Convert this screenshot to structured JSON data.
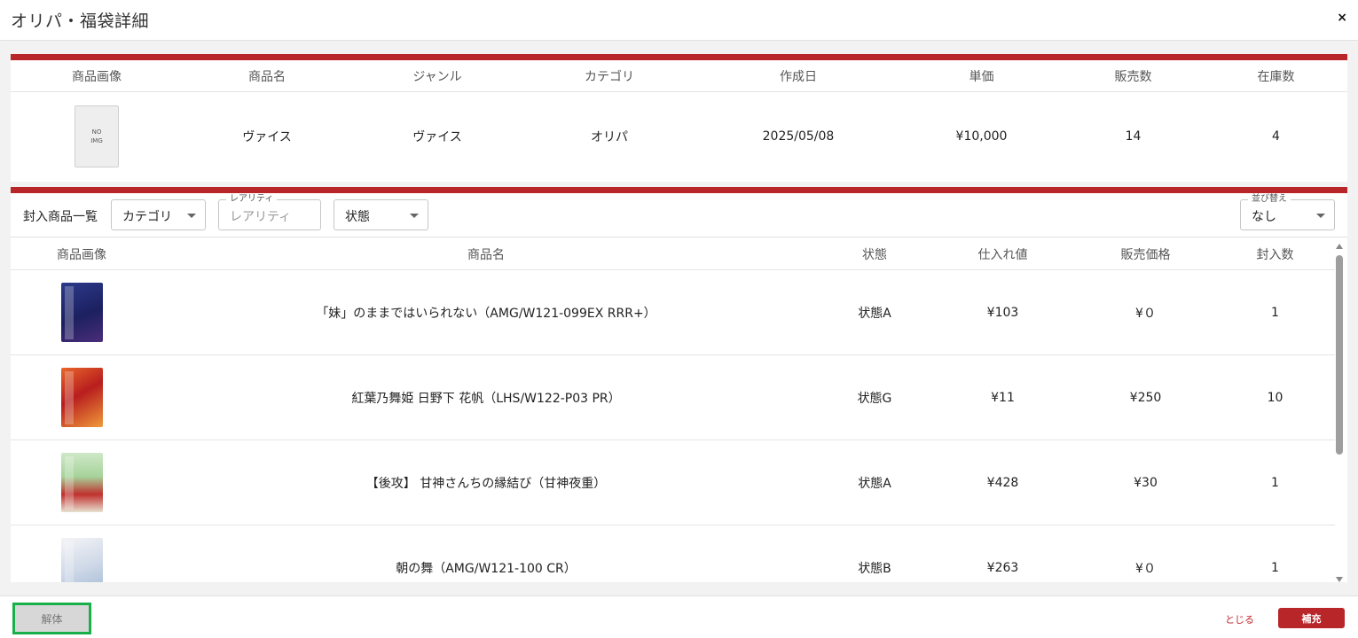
{
  "modal": {
    "title": "オリパ・福袋詳細",
    "close": "×"
  },
  "summary": {
    "headers": [
      "商品画像",
      "商品名",
      "ジャンル",
      "カテゴリ",
      "作成日",
      "単価",
      "販売数",
      "在庫数"
    ],
    "row": {
      "image_line1": "NO",
      "image_line2": "IMG",
      "name": "ヴァイス",
      "genre": "ヴァイス",
      "category": "オリパ",
      "created": "2025/05/08",
      "unit_price": "¥10,000",
      "sold": "14",
      "stock": "4"
    }
  },
  "filters": {
    "label": "封入商品一覧",
    "category": "カテゴリ",
    "rarity_label": "レアリティ",
    "rarity_placeholder": "レアリティ",
    "condition": "状態",
    "sort_label": "並び替え",
    "sort_value": "なし"
  },
  "list": {
    "headers": [
      "商品画像",
      "商品名",
      "状態",
      "仕入れ値",
      "販売価格",
      "封入数"
    ],
    "rows": [
      {
        "name": "「妹」のままではいられない（AMG/W121-099EX RRR+）",
        "condition": "状態A",
        "cost": "¥103",
        "price": "¥０",
        "qty": "1",
        "card": "purple"
      },
      {
        "name": "紅葉乃舞姫 日野下 花帆（LHS/W122-P03 PR）",
        "condition": "状態G",
        "cost": "¥11",
        "price": "¥250",
        "qty": "10",
        "card": "red"
      },
      {
        "name": "【後攻】 甘神さんちの縁結び（甘神夜重）",
        "condition": "状態A",
        "cost": "¥428",
        "price": "¥30",
        "qty": "1",
        "card": "green"
      },
      {
        "name": "朝の舞（AMG/W121-100 CR）",
        "condition": "状態B",
        "cost": "¥263",
        "price": "¥０",
        "qty": "1",
        "card": "white"
      }
    ]
  },
  "footer": {
    "dissolve": "解体",
    "close": "とじる",
    "supply": "補充"
  },
  "colors": {
    "accent": "#b8262a",
    "highlight": "#19b04a"
  }
}
